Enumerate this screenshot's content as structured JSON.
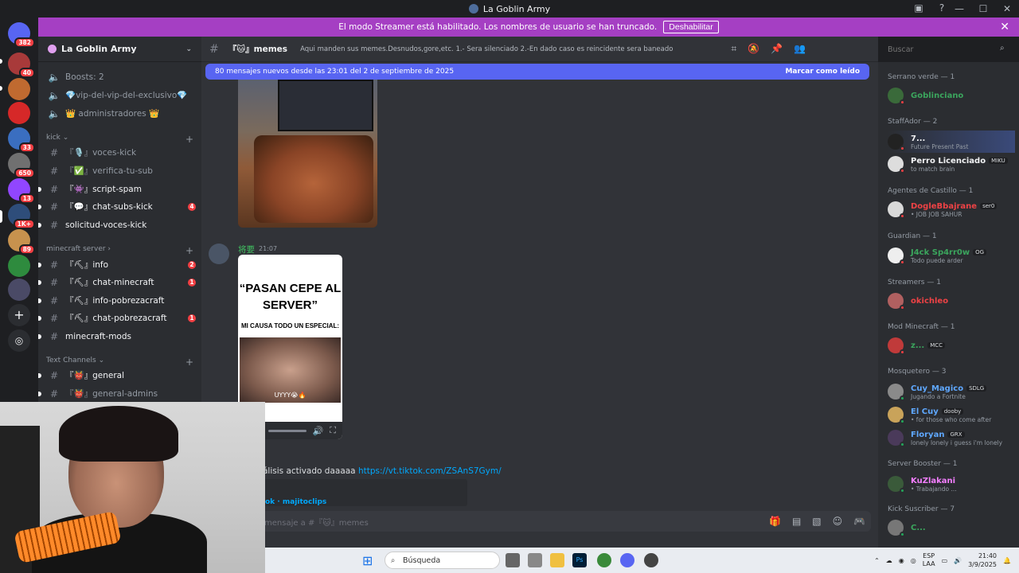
{
  "window": {
    "title": "La Goblin Army"
  },
  "banner": {
    "text": "El modo Streamer está habilitado. Los nombres de usuario se han truncado.",
    "button": "Deshabilitar",
    "close": "✕"
  },
  "servers": [
    {
      "badge": "382"
    },
    {
      "badge": "40"
    },
    {
      "badge": ""
    },
    {
      "badge": ""
    },
    {
      "badge": "33"
    },
    {
      "badge": "650"
    },
    {
      "badge": "13"
    },
    {
      "badge": "1K+"
    },
    {
      "badge": "89"
    },
    {
      "badge": ""
    },
    {
      "badge": ""
    }
  ],
  "guild": {
    "name": "La Goblin Army"
  },
  "channels": {
    "top": [
      {
        "label": "Boosts: 2"
      },
      {
        "label": "💎vip-del-vip-del-exclusivo💎"
      },
      {
        "label": "👑 administradores 👑"
      }
    ],
    "kick": {
      "category": "kick",
      "items": [
        {
          "label": "『🎙️』voces-kick",
          "badge": ""
        },
        {
          "label": "『✅』verifica-tu-sub",
          "badge": ""
        },
        {
          "label": "『👾』script-spam",
          "badge": ""
        },
        {
          "label": "『💬』chat-subs-kick",
          "badge": "4"
        },
        {
          "label": "solicitud-voces-kick",
          "badge": ""
        }
      ]
    },
    "minecraft": {
      "category": "minecraft server",
      "items": [
        {
          "label": "『⛏』info",
          "badge": "2"
        },
        {
          "label": "『⛏』chat-minecraft",
          "badge": "1"
        },
        {
          "label": "『⛏』info-pobrezacraft",
          "badge": ""
        },
        {
          "label": "『⛏』chat-pobrezacraft",
          "badge": "1"
        },
        {
          "label": "minecraft-mods",
          "badge": ""
        }
      ]
    },
    "text": {
      "category": "Text Channels",
      "items": [
        {
          "label": "『👹』general"
        },
        {
          "label": "『👹』general-admins"
        }
      ]
    }
  },
  "channel_header": {
    "name": "『🐱』memes",
    "topic": "Aqui manden sus memes.Desnudos,gore,etc. 1.- Sera silenciado 2.-En dado caso es reincidente sera baneado"
  },
  "search": {
    "placeholder": "Buscar"
  },
  "new_messages": {
    "text": "80 mensajes nuevos desde las 23:01 del 2 de septiembre de 2025",
    "action": "Marcar como leído"
  },
  "messages": {
    "author": "将要",
    "time": "21:07",
    "meme_title": "“PASAN CEPE AL SERVER”",
    "meme_sub": "MI CAUSA TODO UN ESPECIAL:",
    "meme_caption": "UYYY😭🔥",
    "link_text": "álisis activado daaaaa",
    "link_url": "https://vt.tiktok.com/ZSAnS7Gym/",
    "embed_provider": "ok · majitoclips"
  },
  "composer": {
    "placeholder": "mensaje a #『🐱』memes"
  },
  "members": {
    "groups": [
      {
        "title": "Serrano verde — 1",
        "members": [
          {
            "name": "Goblinciano",
            "color": "#3ba55d",
            "status": "",
            "tag": ""
          }
        ]
      },
      {
        "title": "StaffAdor — 2",
        "members": [
          {
            "name": "7...",
            "color": "#f2f3f5",
            "status": "Future Present Past",
            "tag": ""
          },
          {
            "name": "Perro Licenciado",
            "color": "#f2f3f5",
            "status": "to match brain",
            "tag": "MIKU"
          }
        ]
      },
      {
        "title": "Agentes de Castillo — 1",
        "members": [
          {
            "name": "DogleBbajrane",
            "color": "#ed4245",
            "status": "• JOB JOB SAHUR",
            "tag": "ser0"
          }
        ]
      },
      {
        "title": "Guardian — 1",
        "members": [
          {
            "name": "J4ck Sp4rr0w",
            "color": "#3ba55d",
            "status": "Todo puede arder",
            "tag": "OG"
          }
        ]
      },
      {
        "title": "Streamers — 1",
        "members": [
          {
            "name": "okichleo",
            "color": "#ed4245",
            "status": "",
            "tag": ""
          }
        ]
      },
      {
        "title": "Mod Minecraft — 1",
        "members": [
          {
            "name": "z...",
            "color": "#3ba55d",
            "status": "",
            "tag": "MCC"
          }
        ]
      },
      {
        "title": "Mosquetero — 3",
        "members": [
          {
            "name": "Cuy_Magico",
            "color": "#5fa8ff",
            "status": "Jugando a Fortnite",
            "tag": "SDLG"
          },
          {
            "name": "El Cuy",
            "color": "#5fa8ff",
            "status": "• for those who come after",
            "tag": "dooby"
          },
          {
            "name": "Floryan",
            "color": "#5fa8ff",
            "status": "lonely lonely i guess i'm lonely",
            "tag": "GRX"
          }
        ]
      },
      {
        "title": "Server Booster — 1",
        "members": [
          {
            "name": "KuZlakani",
            "color": "#f47fff",
            "status": "• Trabajando ...",
            "tag": ""
          }
        ]
      },
      {
        "title": "Kick Suscriber — 7",
        "members": [
          {
            "name": "C...",
            "color": "#3ba55d",
            "status": "",
            "tag": ""
          }
        ]
      }
    ]
  },
  "taskbar": {
    "search": "Búsqueda",
    "lang": "ESP",
    "lang2": "LAA",
    "time": "21:40",
    "date": "3/9/2025"
  }
}
